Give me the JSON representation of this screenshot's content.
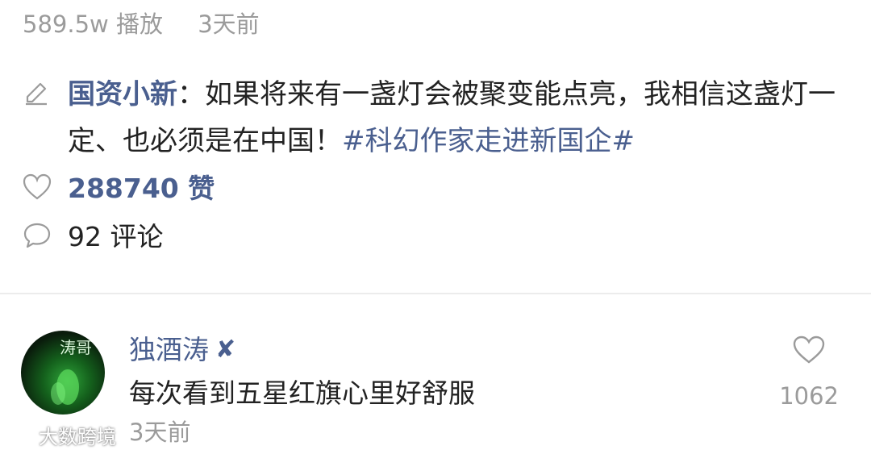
{
  "header": {
    "plays": "589.5w 播放",
    "time": "3天前"
  },
  "post": {
    "author": "国资小新",
    "colon": "：",
    "text": "如果将来有一盏灯会被聚变能点亮，我相信这盏灯一定、也必须是在中国！",
    "hashtag": "#科幻作家走进新国企#",
    "likes_label": "288740 赞",
    "comments_label": "92 评论"
  },
  "comment": {
    "username": "独酒涛",
    "badge": "✘",
    "text": "每次看到五星红旗心里好舒服",
    "time": "3天前",
    "like_count": "1062",
    "avatar_text": "涛哥"
  },
  "watermark": {
    "text": "大数跨境"
  },
  "colors": {
    "link": "#4a5f8f",
    "muted": "#9b9b9b",
    "text": "#222222"
  }
}
